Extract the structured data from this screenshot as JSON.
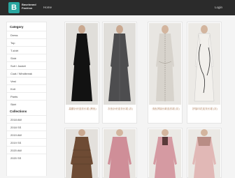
{
  "header": {
    "logo_letter": "B",
    "brand_line1": "Basebrand",
    "brand_line2": "Fashion",
    "nav_home": "Home",
    "nav_login": "Login"
  },
  "sidebar": {
    "category_title": "Category",
    "categories": [
      "Dress",
      "Top",
      "T-shirt",
      "Shirt",
      "Suit / Jacket",
      "Coat / Windbreak",
      "Vest",
      "Knit",
      "Pants",
      "Skirt"
    ],
    "collections_title": "Collections",
    "collections": [
      "2018 AW",
      "2018 SS",
      "2019 AW",
      "2019 SS",
      "2020 AW",
      "2020 SS"
    ]
  },
  "products": [
    {
      "caption": "高腰针织连衣长裙 (黑色)",
      "color": "#121212",
      "accent": "#3a3a3a"
    },
    {
      "caption": "灰色针织连衣长裙 (灰)",
      "color": "#4d4d4f",
      "accent": "#6a6a6a"
    },
    {
      "caption": "浅色拼接长款连衣裙 (灰)",
      "color": "#d7d3cc",
      "accent": "#9a938a"
    },
    {
      "caption": "拼接印花连衣长裙 (灰)",
      "color": "#ece9e4",
      "accent": "#2a2a2a"
    },
    {
      "caption": "",
      "color": "#6e4b34",
      "accent": "#4a3020"
    },
    {
      "caption": "",
      "color": "#cf8e98",
      "accent": "#b97a84"
    },
    {
      "caption": "",
      "color": "#d59aa2",
      "accent": "#5a3a3a"
    },
    {
      "caption": "",
      "color": "#e1b8b6",
      "accent": "#a87a70"
    }
  ],
  "colors": {
    "accent": "#29a6a0",
    "header_bg": "#2b2b2b",
    "caption": "#b58a6a"
  }
}
